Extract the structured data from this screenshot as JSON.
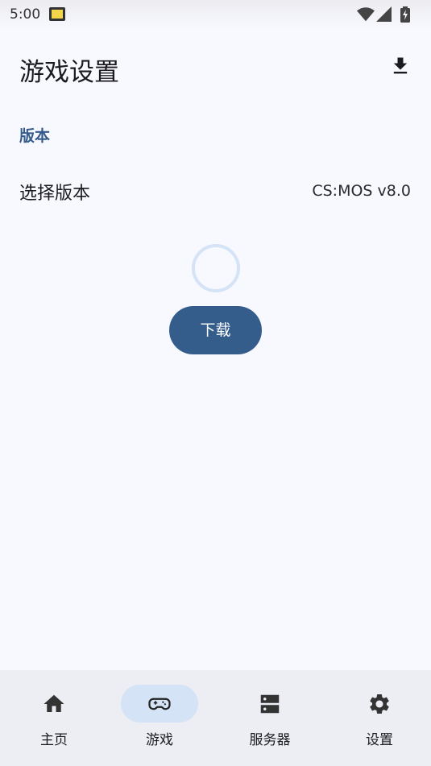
{
  "status_bar": {
    "time": "5:00"
  },
  "header": {
    "title": "游戏设置",
    "action_icon": "download-icon"
  },
  "version_section": {
    "header": "版本",
    "row_label": "选择版本",
    "row_value": "CS:MOS v8.0"
  },
  "download_button": {
    "label": "下载"
  },
  "bottom_nav": {
    "items": [
      {
        "label": "主页",
        "icon": "home-icon",
        "active": false
      },
      {
        "label": "游戏",
        "icon": "gamepad-icon",
        "active": true
      },
      {
        "label": "服务器",
        "icon": "server-icon",
        "active": false
      },
      {
        "label": "设置",
        "icon": "gear-icon",
        "active": false
      }
    ]
  },
  "colors": {
    "accent": "#345d8c",
    "active_indicator": "#d5e3f6",
    "background": "#f8f9ff",
    "nav_background": "#eceef4"
  }
}
